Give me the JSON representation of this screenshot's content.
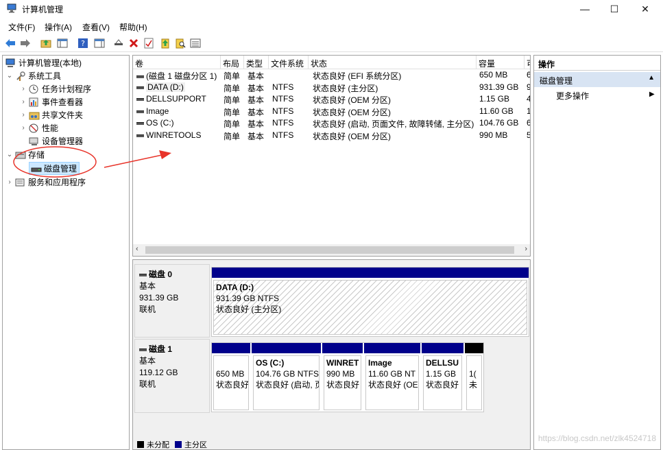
{
  "window": {
    "title": "计算机管理",
    "controls": {
      "minimize": "—",
      "maximize": "☐",
      "close": "✕"
    }
  },
  "menu": [
    "文件(F)",
    "操作(A)",
    "查看(V)",
    "帮助(H)"
  ],
  "tree": {
    "root": "计算机管理(本地)",
    "system_tools": "系统工具",
    "task_scheduler": "任务计划程序",
    "event_viewer": "事件查看器",
    "shared_folders": "共享文件夹",
    "performance": "性能",
    "device_manager": "设备管理器",
    "storage": "存储",
    "disk_management": "磁盘管理",
    "services": "服务和应用程序"
  },
  "volume_list": {
    "headers": [
      "卷",
      "布局",
      "类型",
      "文件系统",
      "状态",
      "容量",
      "可"
    ],
    "rows": [
      [
        "(磁盘 1 磁盘分区 1)",
        "简单",
        "基本",
        "",
        "状态良好 (EFI 系统分区)",
        "650 MB",
        "6"
      ],
      [
        "DATA (D:)",
        "简单",
        "基本",
        "NTFS",
        "状态良好 (主分区)",
        "931.39 GB",
        "9"
      ],
      [
        "DELLSUPPORT",
        "简单",
        "基本",
        "NTFS",
        "状态良好 (OEM 分区)",
        "1.15 GB",
        "4"
      ],
      [
        "Image",
        "简单",
        "基本",
        "NTFS",
        "状态良好 (OEM 分区)",
        "11.60 GB",
        "1"
      ],
      [
        "OS (C:)",
        "简单",
        "基本",
        "NTFS",
        "状态良好 (启动, 页面文件, 故障转储, 主分区)",
        "104.76 GB",
        "6"
      ],
      [
        "WINRETOOLS",
        "简单",
        "基本",
        "NTFS",
        "状态良好 (OEM 分区)",
        "990 MB",
        "5"
      ]
    ]
  },
  "disks": [
    {
      "name": "磁盘 0",
      "type": "基本",
      "size": "931.39 GB",
      "state": "联机",
      "partitions": [
        {
          "name": "DATA  (D:)",
          "size": "931.39 GB NTFS",
          "status": "状态良好 (主分区)"
        }
      ]
    },
    {
      "name": "磁盘 1",
      "type": "基本",
      "size": "119.12 GB",
      "state": "联机",
      "partitions": [
        {
          "name": "",
          "size": "650 MB",
          "status": "状态良好"
        },
        {
          "name": "OS  (C:)",
          "size": "104.76 GB NTFS",
          "status": "状态良好 (启动, 页"
        },
        {
          "name": "WINRET",
          "size": "990 MB",
          "status": "状态良好"
        },
        {
          "name": "Image",
          "size": "11.60 GB NT",
          "status": "状态良好 (OE"
        },
        {
          "name": "DELLSU",
          "size": "1.15 GB",
          "status": "状态良好"
        },
        {
          "name": "",
          "size": "1(",
          "status": "未"
        }
      ]
    }
  ],
  "legend": {
    "unallocated": "未分配",
    "primary": "主分区"
  },
  "actions": {
    "title": "操作",
    "section": "磁盘管理",
    "more": "更多操作"
  },
  "watermark": "https://blog.csdn.net/zlk4524718",
  "colors": {
    "partition_bar": "#00008b",
    "selection": "#cce8ff",
    "annotation": "#e8342a",
    "action_section": "#d8e4f3"
  }
}
